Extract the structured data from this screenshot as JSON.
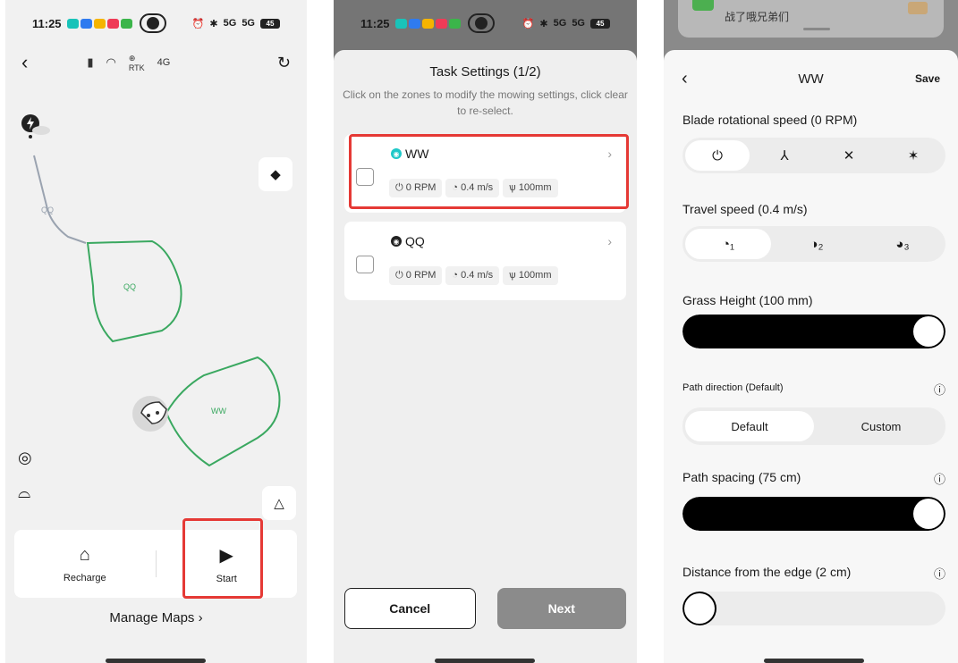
{
  "status": {
    "time": "11:25",
    "battery": "45",
    "signal1": "5G",
    "signal2": "5G"
  },
  "map_screen": {
    "zones": [
      {
        "name": "QQ"
      },
      {
        "name": "WW"
      }
    ],
    "path_label": "QQ",
    "actions": {
      "recharge": "Recharge",
      "start": "Start"
    },
    "manage_maps": "Manage Maps"
  },
  "task_settings": {
    "title": "Task Settings (1/2)",
    "hint": "Click on the zones to modify the mowing settings, click clear to re-select.",
    "zones": [
      {
        "name": "WW",
        "rpm": "0 RPM",
        "speed": "0.4 m/s",
        "height": "100mm",
        "dot_color": "#1ec8c8"
      },
      {
        "name": "QQ",
        "rpm": "0 RPM",
        "speed": "0.4 m/s",
        "height": "100mm",
        "dot_color": "#222222"
      }
    ],
    "cancel": "Cancel",
    "next": "Next"
  },
  "zone_settings": {
    "notification": "战了哦兄弟们",
    "title": "WW",
    "save": "Save",
    "blade_label": "Blade rotational speed (0 RPM)",
    "travel_label": "Travel speed (0.4 m/s)",
    "grass_label": "Grass Height (100 mm)",
    "grass_level": 1.0,
    "path_dir_label": "Path direction (Default)",
    "path_dir_options": [
      "Default",
      "Custom"
    ],
    "spacing_label": "Path spacing (75 cm)",
    "spacing_level": 1.0,
    "edge_label": "Distance from the edge (2 cm)",
    "edge_level": 0.0
  },
  "colors": {
    "highlight": "#e53935",
    "zone_outline": "#3aa860",
    "zone_ww_dot": "#1ec8c8"
  }
}
